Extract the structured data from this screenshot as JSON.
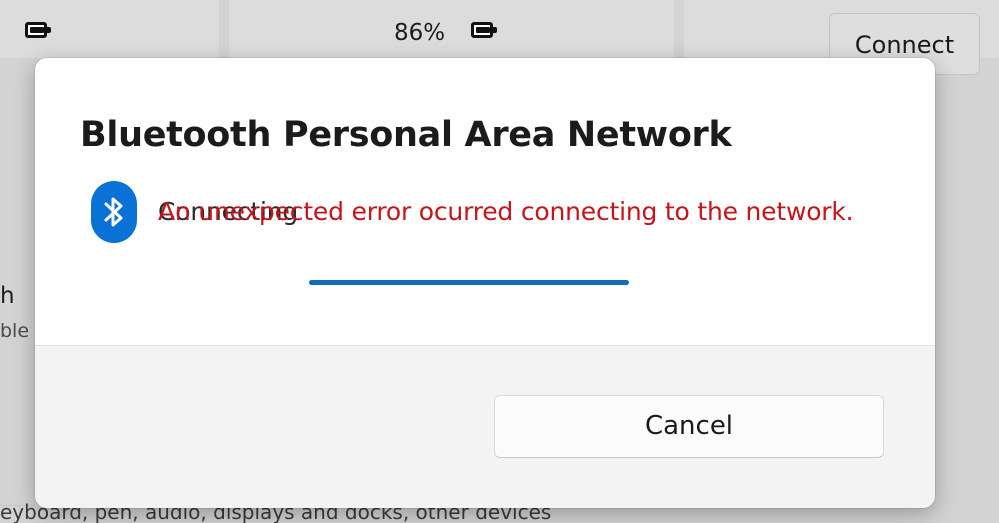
{
  "background": {
    "battery_percent_label": "86%",
    "connect_button_label": "Connect",
    "partial_label_1": "h",
    "partial_label_2": "ble",
    "bottom_description": "eyboard, pen, audio, displays and docks, other devices"
  },
  "dialog": {
    "title": "Bluetooth Personal Area Network",
    "status_text": "Connecting",
    "error_text": "An unexpected error ocurred connecting to the network.",
    "progress_fraction": 1.0,
    "cancel_label": "Cancel"
  },
  "colors": {
    "accent": "#0f6cbd",
    "bluetooth_icon_bg": "#0a72d6",
    "error": "#c4151d"
  },
  "icons": [
    "battery-icon",
    "bluetooth-icon"
  ]
}
